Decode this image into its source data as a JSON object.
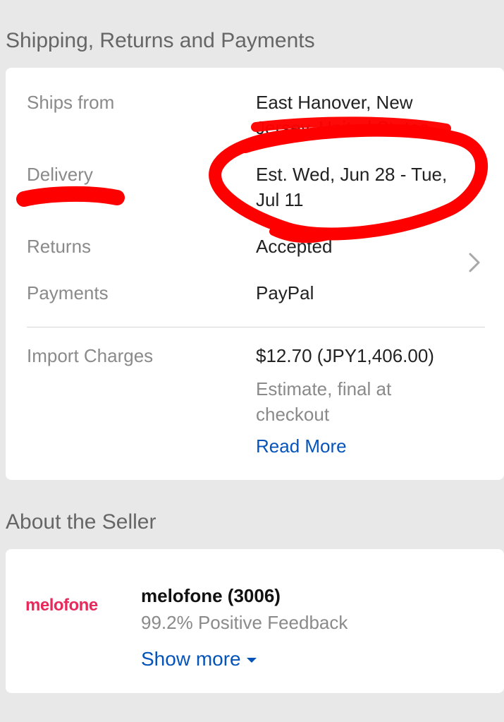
{
  "shipping": {
    "section_title": "Shipping, Returns and Payments",
    "ships_from": {
      "label": "Ships from",
      "value_line1": "East Hanover, New",
      "value_line2": "Jersey, United States"
    },
    "delivery": {
      "label": "Delivery",
      "value_line1": "Est. Wed, Jun 28 - Tue,",
      "value_line2": "Jul 11"
    },
    "returns": {
      "label": "Returns",
      "value": "Accepted"
    },
    "payments": {
      "label": "Payments",
      "value": "PayPal"
    },
    "import_charges": {
      "label": "Import Charges",
      "value": "$12.70 (JPY1,406.00)",
      "note_line1": "Estimate, final at",
      "note_line2": "checkout",
      "read_more": "Read More"
    },
    "chevron_icon": "chevron-right-icon"
  },
  "seller": {
    "section_title": "About the Seller",
    "logo_text": "melofone",
    "name": "melofone (3006)",
    "feedback": "99.2% Positive Feedback",
    "show_more": "Show more",
    "caret_icon": "caret-down-icon"
  },
  "annotation": {
    "color": "#ff0000"
  },
  "colors": {
    "background": "#e8e8e8",
    "card": "#ffffff",
    "link": "#0654ba",
    "brand": "#e8295b"
  }
}
